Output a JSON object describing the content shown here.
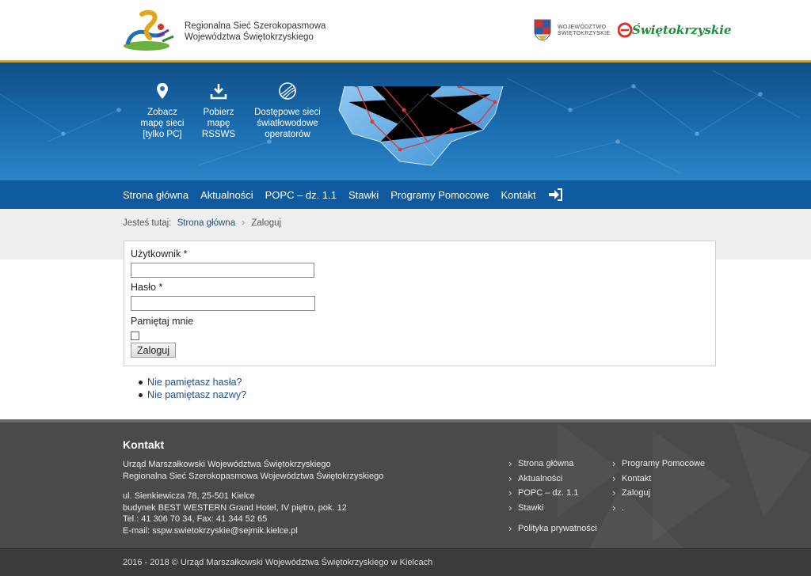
{
  "header": {
    "brand_line1": "Regionalna Sieć Szerokopasmowa",
    "brand_line2": "Województwa Świętokrzyskiego",
    "woj_line1": "WOJEWÓDZTWO",
    "woj_line2": "ŚWIĘTOKRZYSKIE",
    "eswk_text": "Świętokrzyskie"
  },
  "banner": {
    "links": [
      {
        "icon": "map-pin-icon",
        "lines": [
          "Zobacz",
          "mapę sieci",
          "[tylko PC]"
        ]
      },
      {
        "icon": "download-icon",
        "lines": [
          "Pobierz",
          "mapę",
          "RSSWS"
        ]
      },
      {
        "icon": "fiber-optic-icon",
        "lines": [
          "Dostępowe sieci",
          "światłowodowe",
          "operatorów"
        ]
      }
    ]
  },
  "nav": {
    "items": [
      "Strona główna",
      "Aktualności",
      "POPC – dz. 1.1",
      "Stawki",
      "Programy Pomocowe",
      "Kontakt"
    ],
    "login_icon": "sign-in-icon"
  },
  "breadcrumb": {
    "prefix": "Jesteś tutaj:",
    "home": "Strona główna",
    "separator": "›",
    "current": "Zaloguj"
  },
  "login_form": {
    "username_label": "Użytkownik *",
    "username_value": "",
    "password_label": "Hasło *",
    "password_value": "",
    "remember_label": "Pamiętaj mnie",
    "submit_label": "Zaloguj"
  },
  "help_links": [
    "Nie pamiętasz hasła?",
    "Nie pamiętasz nazwy?"
  ],
  "footer": {
    "title": "Kontakt",
    "org_line1": "Urząd Marszałkowski Województwa Świętokrzyskiego",
    "org_line2": "Regionalna Sieć Szerokopasmowa Województwa Świętokrzyskiego",
    "addr_line1": "ul. Sienkiewicza 78, 25-501 Kielce",
    "addr_line2": "budynek BEST WESTERN Grand Hotel, IV piętro, pok. 12",
    "phone_line": "Tel.: 41 306 70 34, Fax: 41 344 52 65",
    "email_line": "E-mail: sspw.swietokrzyskie@sejmik.kielce.pl",
    "col1": [
      "Strona główna",
      "Aktualności",
      "POPC – dz. 1.1",
      "Stawki"
    ],
    "col1_extra": "Polityka prywatności",
    "col2": [
      "Programy Pomocowe",
      "Kontakt",
      "Zaloguj",
      "."
    ],
    "copyright": "2016 - 2018 © Urząd Marszałkowski Województwa Świętokrzyskiego w Kielcach"
  },
  "colors": {
    "nav_bg": "#0d5aa0",
    "banner_dark": "#0f4f87",
    "link": "#1f4f8a",
    "footer_bg": "#4a4a4a",
    "gold": "#c9a54b"
  }
}
